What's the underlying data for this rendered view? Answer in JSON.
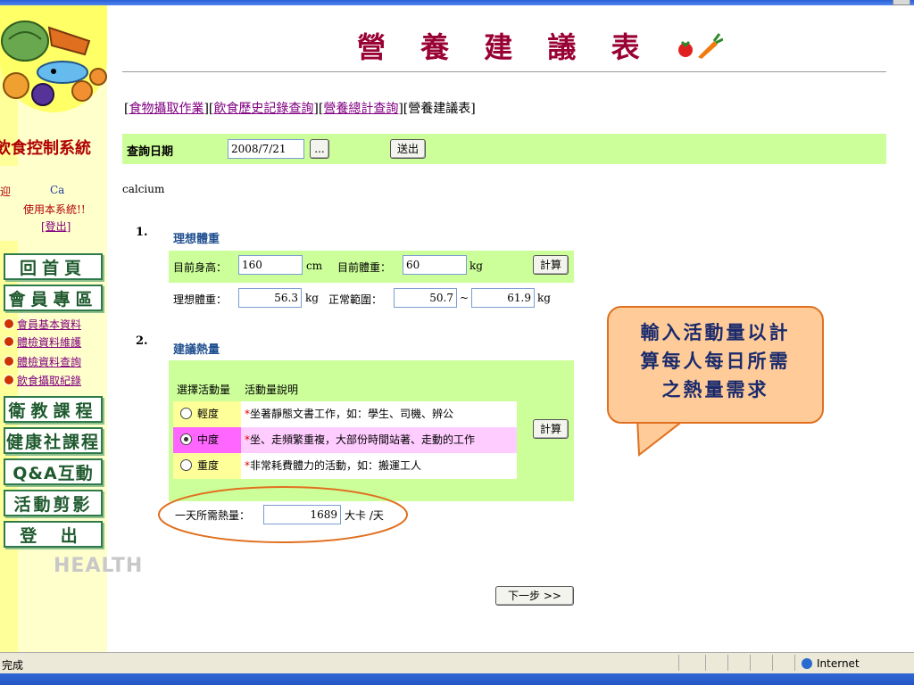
{
  "page": {
    "title": "營 養 建 議 表",
    "breadcrumb": {
      "link1": "食物攝取作業",
      "link2": "飲食歷史記錄查詢",
      "link3": "營養總計查詢",
      "current": "營養建議表"
    }
  },
  "sidebar": {
    "system_title": "飲食控制系統",
    "welcome_prefix": "迎",
    "user": "Ca",
    "welcome_msg": "使用本系統!!",
    "logout": "[登出]",
    "nav": {
      "home": "回首頁",
      "member": "會員專區",
      "sub1": "會員基本資料",
      "sub2": "體檢資料維護",
      "sub3": "體檢資料查詢",
      "sub4": "飲食攝取紀錄",
      "dance": "衛教課程",
      "health": "健康社課程",
      "qa": "Q&A互動區",
      "activity": "活動剪影",
      "logout": "登 出"
    },
    "health_logo": "HEALTH"
  },
  "query": {
    "label": "查詢日期",
    "date_value": "2008/7/21",
    "picker_label": "...",
    "submit_label": "送出"
  },
  "user_note": "calcium",
  "section1": {
    "num": "1.",
    "heading": "理想體重",
    "height_label": "目前身高：",
    "height_value": "160",
    "height_unit": "cm",
    "weight_label": "目前體重：",
    "weight_value": "60",
    "weight_unit": "kg",
    "calc_label": "計算",
    "ideal_label": "理想體重：",
    "ideal_value": "56.3",
    "ideal_unit": "kg",
    "range_label": "正常範圍：",
    "range_min": "50.7",
    "range_sep": "~",
    "range_max": "61.9",
    "range_unit": "kg"
  },
  "section2": {
    "num": "2.",
    "heading": "建議熱量",
    "col1": "選擇活動量",
    "col2": "活動量說明",
    "activities": [
      {
        "level": "輕度",
        "desc": "坐著靜態文書工作，如：學生、司機、辨公",
        "selected": false
      },
      {
        "level": "中度",
        "desc": "坐、走頻繁重複，大部份時間站著、走動的工作",
        "selected": true
      },
      {
        "level": "重度",
        "desc": "非常耗費體力的活動，如：搬運工人",
        "selected": false
      }
    ],
    "calc_label": "計算",
    "daily_label": "一天所需熱量：",
    "daily_value": "1689",
    "daily_unit": "大卡 /天"
  },
  "next_label": "下一步 >>",
  "callout": {
    "line1": "輸入活動量以計",
    "line2": "算每人每日所需",
    "line3": "之熱量需求"
  },
  "statusbar": {
    "left": "完成",
    "zone": "Internet"
  },
  "colors": {
    "panel_green": "#ccff99",
    "title_red": "#990033",
    "selected_magenta": "#ff66ff",
    "callout_fill": "#ffcc99"
  }
}
